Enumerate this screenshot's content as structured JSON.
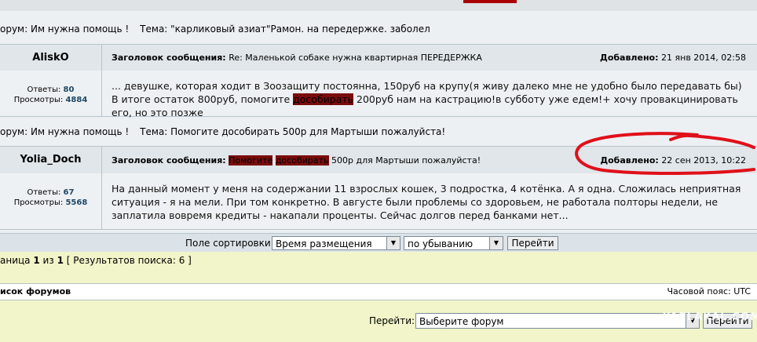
{
  "results": [
    {
      "forum_label": "орум: Им нужна помощь !",
      "topic_label": "Тема: \"карликовый азиат\"Рамон. на передержке. заболел",
      "author": "AliskO",
      "subject_label": "Заголовок сообщения:",
      "subject": "Re: Маленькой собаке нужна квартирная ПЕРЕДЕРЖКА",
      "added_label": "Добавлено:",
      "added": "21 янв 2014, 02:58",
      "replies_label": "Ответы:",
      "replies": "80",
      "views_label": "Просмотры:",
      "views": "4884",
      "body_pre": "... девушке, которая ходит в Зоозащиту постоянна, 150руб на крупу(я живу далеко мне не удобно было передавать бы) В итоге остаток 800руб, помогите ",
      "body_hl": "дособирать",
      "body_post": " 200руб нам на кастрацию!в субботу уже едем!+ хочу провакцинировать его, но это позже"
    },
    {
      "forum_label": "орум: Им нужна помощь !",
      "topic_label": "Тема: Помогите дособирать 500р для Мартыши пожалуйста!",
      "author": "Yolia_Doch",
      "subject_label": "Заголовок сообщения:",
      "subject_hl1": "Помогите",
      "subject_hl2": "дособирать",
      "subject_rest": " 500р для Мартыши пожалуйста!",
      "added_label": "Добавлено:",
      "added": "22 сен 2013, 10:22",
      "replies_label": "Ответы:",
      "replies": "67",
      "views_label": "Просмотры:",
      "views": "5568",
      "body": "На данный момент у меня на содержании 11 взрослых кошек, 3 подростка, 4 котёнка. А я одна. Сложилась неприятная ситуация - я на мели. При том конкретно. В августе были проблемы со здоровьем, не работала полторы недели, не заплатила вовремя кредиты - накапали проценты. Сейчас долгов перед банками нет..."
    }
  ],
  "sort": {
    "label": "Поле сортировки:",
    "field": "Время размещения",
    "order": "по убыванию",
    "go": "Перейти"
  },
  "pager": {
    "prefix": "аница",
    "current": "1",
    "of": "из",
    "total": "1",
    "results": "[ Результатов поиска: 6 ]"
  },
  "footer": {
    "forums_list": "исок форумов",
    "timezone": "Часовой пояс: UTC",
    "jump_label": "Перейти:",
    "jump_select": "Выберите форум",
    "jump_go": "Перейти"
  },
  "watermark": "YAPLAKAL.COM",
  "colors": {
    "highlight": "#7a0c0c",
    "annotation": "#e0101a"
  }
}
